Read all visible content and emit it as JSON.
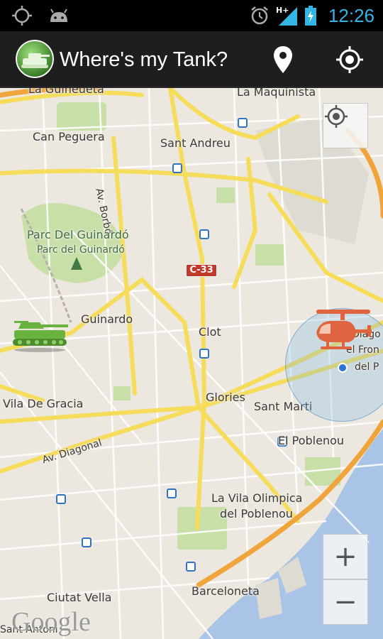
{
  "status_bar": {
    "time": "12:26",
    "left_icons": [
      "gps-icon",
      "android-debug-icon"
    ],
    "right_icons": [
      "alarm-icon",
      "signal-hplus-icon",
      "battery-charging-icon"
    ],
    "accent_color": "#33b5e5"
  },
  "action_bar": {
    "title": "Where's my Tank?",
    "app_icon": "tank-app-icon",
    "actions": [
      {
        "name": "place-pin",
        "icon": "map-pin-icon"
      },
      {
        "name": "my-location",
        "icon": "crosshair-icon"
      }
    ]
  },
  "map": {
    "labels": {
      "la_guineueta": "La Guineueta",
      "la_maquinista": "La Maquinista",
      "can_peguera": "Can Peguera",
      "sant_andreu": "Sant Andreu",
      "av_borbo": "Av. Borbó",
      "parc_guinardo_1": "Parc Del Guinardó",
      "parc_guinardo_2": "Parc del Guinardó",
      "guinardo": "Guinardo",
      "clot": "Clot",
      "vila_de_gracia": "Vila De Gracia",
      "glories": "Glories",
      "sant_marti": "Sant Marti",
      "el_poblenou": "El Poblenou",
      "av_diagonal": "Av. Diagonal",
      "vila_olimpica_1": "La Vila Olimpica",
      "vila_olimpica_2": "del Poblenou",
      "ciutat_vella": "Ciutat Vella",
      "barceloneta": "Barceloneta",
      "sant_antoni": "Sant Antoni",
      "diag_1": "Diago",
      "diag_2": "el Fron",
      "diag_3": "del P"
    },
    "road_shield": "C-33",
    "zoom_in": "+",
    "zoom_out": "−",
    "attribution": "Google",
    "markers": {
      "player": "tank-icon",
      "enemy": "helicopter-icon"
    },
    "colors": {
      "land": "#ece8df",
      "road_major": "#f7e36a",
      "road_minor": "#ffffff",
      "park": "#c9dfa8",
      "water": "#a9c4e6",
      "tank": "#6ab23f",
      "helicopter": "#e0643f"
    }
  }
}
